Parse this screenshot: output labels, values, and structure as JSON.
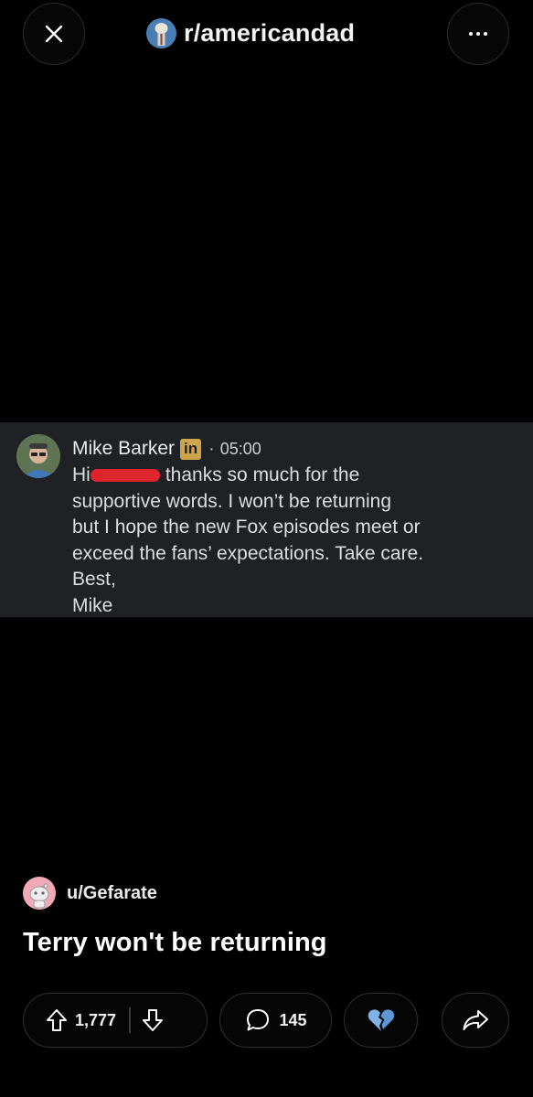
{
  "header": {
    "subreddit": "r/americandad",
    "close_icon": "close-icon",
    "more_icon": "more-icon"
  },
  "message": {
    "sender": "Mike Barker",
    "badge": "in",
    "separator": "·",
    "time": "05:00",
    "greeting": "Hi",
    "lines": [
      "thanks so much for the",
      "supportive words.  I won’t be returning",
      "but I hope the new Fox episodes meet or",
      "exceed the fans’ expectations.  Take care.",
      "Best,",
      "Mike"
    ]
  },
  "post": {
    "author": "u/Gefarate",
    "title": "Terry won't be returning"
  },
  "actions": {
    "upvotes": "1,777",
    "comments": "145",
    "award_icon": "broken-heart-icon",
    "share_icon": "share-icon"
  },
  "colors": {
    "background": "#000000",
    "panel": "#1f2124",
    "linkedin_badge": "#cfa54c",
    "redaction": "#e0242b",
    "award": "#7fb3e8"
  }
}
